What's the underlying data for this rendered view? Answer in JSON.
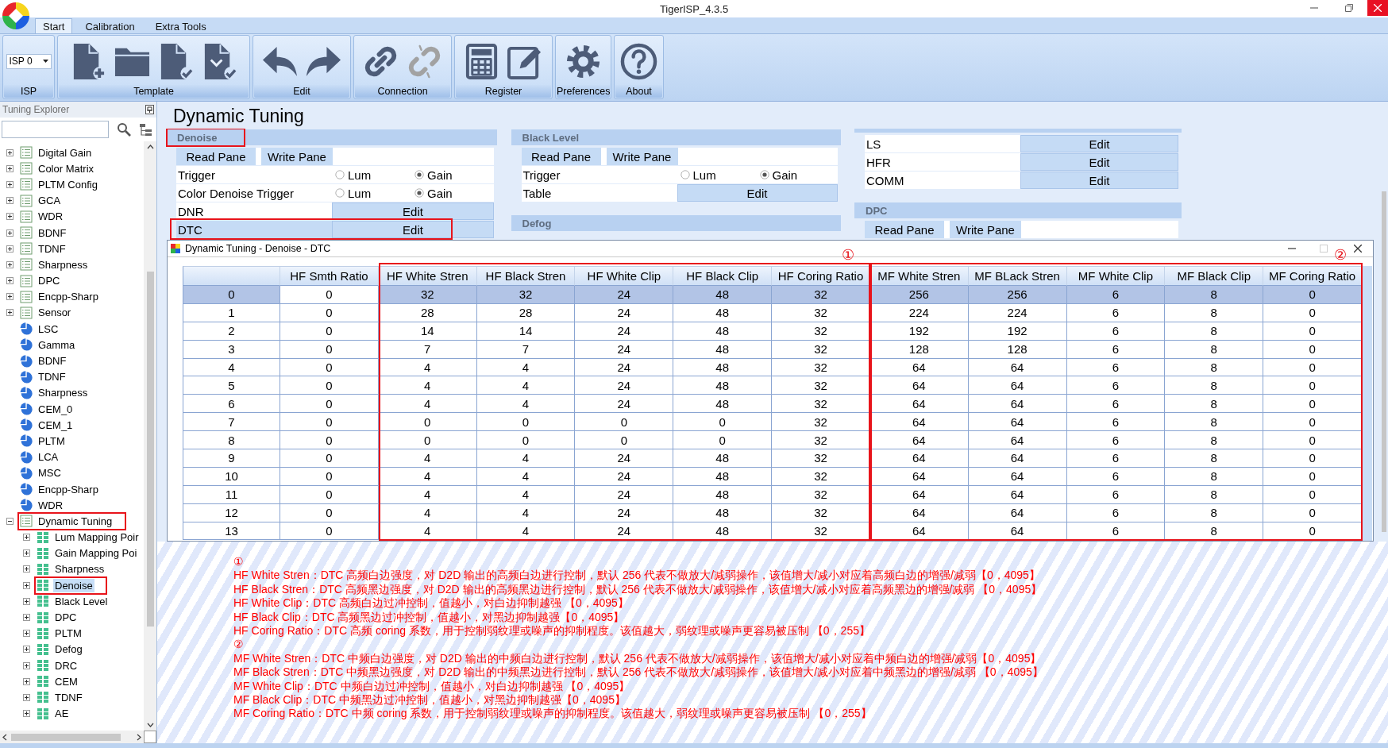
{
  "window": {
    "title": "TigerISP_4.3.5",
    "controls": [
      {
        "kind": "minimize"
      },
      {
        "kind": "restore"
      },
      {
        "kind": "close"
      }
    ]
  },
  "ribbon": {
    "tabs": [
      {
        "label": "Start",
        "selected": true
      },
      {
        "label": "Calibration",
        "selected": false
      },
      {
        "label": "Extra Tools",
        "selected": false
      }
    ],
    "groups": [
      {
        "label": "ISP",
        "dropdown": {
          "value": "ISP 0"
        }
      },
      {
        "label": "Template",
        "tools": [
          {
            "kind": "newfile",
            "disabled": false
          },
          {
            "kind": "folder",
            "disabled": false
          },
          {
            "kind": "filecheck",
            "disabled": false
          },
          {
            "kind": "filesave",
            "disabled": false
          }
        ]
      },
      {
        "label": "Edit",
        "tools": [
          {
            "kind": "undo",
            "disabled": false
          },
          {
            "kind": "redo",
            "disabled": false
          }
        ]
      },
      {
        "label": "Connection",
        "tools": [
          {
            "kind": "link",
            "disabled": false
          },
          {
            "kind": "unlink",
            "disabled": true
          }
        ]
      },
      {
        "label": "Register",
        "tools": [
          {
            "kind": "calculator",
            "disabled": false
          },
          {
            "kind": "edit",
            "disabled": false
          }
        ]
      },
      {
        "label": "Preferences",
        "tools": [
          {
            "kind": "gear",
            "disabled": false
          }
        ]
      },
      {
        "label": "About",
        "tools": [
          {
            "kind": "help",
            "disabled": false
          }
        ]
      }
    ]
  },
  "explorer": {
    "title": "Tuning Explorer",
    "items": [
      {
        "label": "Digital Gain",
        "kind": "node",
        "expanded": false,
        "selected": false,
        "annotated": false
      },
      {
        "label": "Color Matrix",
        "kind": "node",
        "expanded": false,
        "selected": false,
        "annotated": false
      },
      {
        "label": "PLTM Config",
        "kind": "node",
        "expanded": false,
        "selected": false,
        "annotated": false
      },
      {
        "label": "GCA",
        "kind": "node",
        "expanded": false,
        "selected": false,
        "annotated": false
      },
      {
        "label": "WDR",
        "kind": "node",
        "expanded": false,
        "selected": false,
        "annotated": false
      },
      {
        "label": "BDNF",
        "kind": "node",
        "expanded": false,
        "selected": false,
        "annotated": false
      },
      {
        "label": "TDNF",
        "kind": "node",
        "expanded": false,
        "selected": false,
        "annotated": false
      },
      {
        "label": "Sharpness",
        "kind": "node",
        "expanded": false,
        "selected": false,
        "annotated": false
      },
      {
        "label": "DPC",
        "kind": "node",
        "expanded": false,
        "selected": false,
        "annotated": false
      },
      {
        "label": "Encpp-Sharp",
        "kind": "node",
        "expanded": false,
        "selected": false,
        "annotated": false
      },
      {
        "label": "Sensor",
        "kind": "node",
        "expanded": false,
        "selected": false,
        "annotated": false
      },
      {
        "label": "LSC",
        "kind": "leaf",
        "selected": false,
        "annotated": false
      },
      {
        "label": "Gamma",
        "kind": "leaf",
        "selected": false,
        "annotated": false
      },
      {
        "label": "BDNF",
        "kind": "leaf",
        "selected": false,
        "annotated": false
      },
      {
        "label": "TDNF",
        "kind": "leaf",
        "selected": false,
        "annotated": false
      },
      {
        "label": "Sharpness",
        "kind": "leaf",
        "selected": false,
        "annotated": false
      },
      {
        "label": "CEM_0",
        "kind": "leaf",
        "selected": false,
        "annotated": false
      },
      {
        "label": "CEM_1",
        "kind": "leaf",
        "selected": false,
        "annotated": false
      },
      {
        "label": "PLTM",
        "kind": "leaf",
        "selected": false,
        "annotated": false
      },
      {
        "label": "LCA",
        "kind": "leaf",
        "selected": false,
        "annotated": false
      },
      {
        "label": "MSC",
        "kind": "leaf",
        "selected": false,
        "annotated": false
      },
      {
        "label": "Encpp-Sharp",
        "kind": "leaf",
        "selected": false,
        "annotated": false
      },
      {
        "label": "WDR",
        "kind": "leaf",
        "selected": false,
        "annotated": false
      },
      {
        "label": "Dynamic Tuning",
        "kind": "node",
        "expanded": true,
        "selected": false,
        "annotated": true,
        "children": [
          {
            "label": "Lum Mapping Poir",
            "kind": "grid",
            "expanded": false,
            "selected": false,
            "annotated": false
          },
          {
            "label": "Gain Mapping Poi",
            "kind": "grid",
            "expanded": false,
            "selected": false,
            "annotated": false
          },
          {
            "label": "Sharpness",
            "kind": "grid",
            "expanded": false,
            "selected": false,
            "annotated": false
          },
          {
            "label": "Denoise",
            "kind": "grid",
            "expanded": false,
            "selected": true,
            "annotated": true
          },
          {
            "label": "Black Level",
            "kind": "grid",
            "expanded": false,
            "selected": false,
            "annotated": false
          },
          {
            "label": "DPC",
            "kind": "grid",
            "expanded": false,
            "selected": false,
            "annotated": false
          },
          {
            "label": "PLTM",
            "kind": "grid",
            "expanded": false,
            "selected": false,
            "annotated": false
          },
          {
            "label": "Defog",
            "kind": "grid",
            "expanded": false,
            "selected": false,
            "annotated": false
          },
          {
            "label": "DRC",
            "kind": "grid",
            "expanded": false,
            "selected": false,
            "annotated": false
          },
          {
            "label": "CEM",
            "kind": "grid",
            "expanded": false,
            "selected": false,
            "annotated": false
          },
          {
            "label": "TDNF",
            "kind": "grid",
            "expanded": false,
            "selected": false,
            "annotated": false
          },
          {
            "label": "AE",
            "kind": "grid",
            "expanded": false,
            "selected": false,
            "annotated": false
          }
        ]
      }
    ]
  },
  "page": {
    "title": "Dynamic Tuning",
    "columns": [
      {
        "panels": [
          {
            "title": "Denoise",
            "annotated": true,
            "pane_buttons": [
              "Read Pane",
              "Write Pane"
            ],
            "rows": [
              {
                "kind": "radio",
                "label": "Trigger",
                "selected": false,
                "annotated": false,
                "options": [
                  {
                    "label": "Lum",
                    "selected": false
                  },
                  {
                    "label": "Gain",
                    "selected": true
                  }
                ]
              },
              {
                "kind": "radio",
                "label": "Color Denoise Trigger",
                "selected": false,
                "annotated": false,
                "options": [
                  {
                    "label": "Lum",
                    "selected": false
                  },
                  {
                    "label": "Gain",
                    "selected": true
                  }
                ]
              },
              {
                "kind": "edit",
                "label": "DNR",
                "button": "Edit",
                "selected": false,
                "annotated": false
              },
              {
                "kind": "edit",
                "label": "DTC",
                "button": "Edit",
                "selected": true,
                "annotated": true
              }
            ]
          }
        ]
      },
      {
        "panels": [
          {
            "title": "Black Level",
            "annotated": false,
            "pane_buttons": [
              "Read Pane",
              "Write Pane"
            ],
            "rows": [
              {
                "kind": "radio",
                "label": "Trigger",
                "selected": false,
                "annotated": false,
                "options": [
                  {
                    "label": "Lum",
                    "selected": false
                  },
                  {
                    "label": "Gain",
                    "selected": true
                  }
                ]
              },
              {
                "kind": "edit",
                "label": "Table",
                "button": "Edit",
                "selected": false,
                "annotated": false
              }
            ]
          },
          {
            "title": "Defog",
            "annotated": false
          }
        ]
      },
      {
        "panels": [
          {
            "rows": [
              {
                "kind": "edit",
                "label": "LS",
                "button": "Edit",
                "selected": false,
                "annotated": false
              },
              {
                "kind": "edit",
                "label": "HFR",
                "button": "Edit",
                "selected": false,
                "annotated": false
              },
              {
                "kind": "edit",
                "label": "COMM",
                "button": "Edit",
                "selected": false,
                "annotated": false
              }
            ]
          },
          {
            "title": "DPC",
            "annotated": false,
            "pane_buttons": [
              "Read Pane",
              "Write Pane"
            ]
          }
        ]
      }
    ]
  },
  "dialog": {
    "title": "Dynamic Tuning - Denoise - DTC",
    "controls": [
      {
        "kind": "minimize",
        "disabled": false
      },
      {
        "kind": "maximize",
        "disabled": true
      },
      {
        "kind": "close",
        "disabled": false
      }
    ],
    "table": {
      "column_groups": [
        {
          "columns": [
            {
              "label": "HF Smth Ratio",
              "selected": true
            }
          ]
        },
        {
          "callout": "①",
          "columns": [
            {
              "label": "HF White Stren",
              "selected": false
            },
            {
              "label": "HF Black Stren",
              "selected": false
            },
            {
              "label": "HF White Clip",
              "selected": false
            },
            {
              "label": "HF Black Clip",
              "selected": false
            },
            {
              "label": "HF Coring Ratio",
              "selected": false
            }
          ]
        },
        {
          "callout": "②",
          "columns": [
            {
              "label": "MF White Stren",
              "selected": false
            },
            {
              "label": "MF BLack Stren",
              "selected": false
            },
            {
              "label": "MF White Clip",
              "selected": false
            },
            {
              "label": "MF Black Clip",
              "selected": false
            },
            {
              "label": "MF Coring Ratio",
              "selected": false
            }
          ]
        }
      ],
      "rows": [
        {
          "label": "0",
          "selected": true,
          "cells": [
            "0",
            "32",
            "32",
            "24",
            "48",
            "32",
            "256",
            "256",
            "6",
            "8",
            "0"
          ]
        },
        {
          "label": "1",
          "selected": false,
          "cells": [
            "0",
            "28",
            "28",
            "24",
            "48",
            "32",
            "224",
            "224",
            "6",
            "8",
            "0"
          ]
        },
        {
          "label": "2",
          "selected": false,
          "cells": [
            "0",
            "14",
            "14",
            "24",
            "48",
            "32",
            "192",
            "192",
            "6",
            "8",
            "0"
          ]
        },
        {
          "label": "3",
          "selected": false,
          "cells": [
            "0",
            "7",
            "7",
            "24",
            "48",
            "32",
            "128",
            "128",
            "6",
            "8",
            "0"
          ]
        },
        {
          "label": "4",
          "selected": false,
          "cells": [
            "0",
            "4",
            "4",
            "24",
            "48",
            "32",
            "64",
            "64",
            "6",
            "8",
            "0"
          ]
        },
        {
          "label": "5",
          "selected": false,
          "cells": [
            "0",
            "4",
            "4",
            "24",
            "48",
            "32",
            "64",
            "64",
            "6",
            "8",
            "0"
          ]
        },
        {
          "label": "6",
          "selected": false,
          "cells": [
            "0",
            "4",
            "4",
            "24",
            "48",
            "32",
            "64",
            "64",
            "6",
            "8",
            "0"
          ]
        },
        {
          "label": "7",
          "selected": false,
          "cells": [
            "0",
            "0",
            "0",
            "0",
            "0",
            "32",
            "64",
            "64",
            "6",
            "8",
            "0"
          ]
        },
        {
          "label": "8",
          "selected": false,
          "cells": [
            "0",
            "0",
            "0",
            "0",
            "0",
            "32",
            "64",
            "64",
            "6",
            "8",
            "0"
          ]
        },
        {
          "label": "9",
          "selected": false,
          "cells": [
            "0",
            "4",
            "4",
            "24",
            "48",
            "32",
            "64",
            "64",
            "6",
            "8",
            "0"
          ]
        },
        {
          "label": "10",
          "selected": false,
          "cells": [
            "0",
            "4",
            "4",
            "24",
            "48",
            "32",
            "64",
            "64",
            "6",
            "8",
            "0"
          ]
        },
        {
          "label": "11",
          "selected": false,
          "cells": [
            "0",
            "4",
            "4",
            "24",
            "48",
            "32",
            "64",
            "64",
            "6",
            "8",
            "0"
          ]
        },
        {
          "label": "12",
          "selected": false,
          "cells": [
            "0",
            "4",
            "4",
            "24",
            "48",
            "32",
            "64",
            "64",
            "6",
            "8",
            "0"
          ]
        },
        {
          "label": "13",
          "selected": false,
          "cells": [
            "0",
            "4",
            "4",
            "24",
            "48",
            "32",
            "64",
            "64",
            "6",
            "8",
            "0"
          ]
        }
      ]
    }
  },
  "notes": [
    {
      "marker": "①",
      "lines": [
        "HF White Stren：DTC 高频白边强度，对 D2D 输出的高频白边进行控制，默认 256 代表不做放大/减弱操作，该值增大/减小对应着高频白边的增强/减弱【0，4095】",
        "HF Black Stren：DTC 高频黑边强度，对 D2D 输出的高频黑边进行控制，默认 256 代表不做放大/减弱操作，该值增大/减小对应着高频黑边的增强/减弱 【0，4095】",
        "HF White Clip：DTC 高频白边过冲控制，值越小，对白边抑制越强 【0，4095】",
        "HF Black Clip：DTC 高频黑边过冲控制，值越小，对黑边抑制越强【0，4095】",
        "HF Coring Ratio：DTC 高频 coring 系数，用于控制弱纹理或噪声的抑制程度。该值越大，弱纹理或噪声更容易被压制 【0，255】"
      ]
    },
    {
      "marker": "②",
      "lines": [
        "MF White Stren：DTC 中频白边强度，对 D2D 输出的中频白边进行控制，默认 256 代表不做放大/减弱操作，该值增大/减小对应着中频白边的增强/减弱【0，4095】",
        "MF Black Stren：DTC 中频黑边强度，对 D2D 输出的中频黑边进行控制，默认 256 代表不做放大/减弱操作，该值增大/减小对应着中频黑边的增强/减弱 【0，4095】",
        "MF White Clip：DTC 中频白边过冲控制，值越小，对白边抑制越强 【0，4095】",
        "MF Black Clip：DTC 中频黑边过冲控制，值越小，对黑边抑制越强【0，4095】",
        "MF Coring Ratio：DTC 中频 coring 系数，用于控制弱纹理或噪声的抑制程度。该值越大，弱纹理或噪声更容易被压制 【0，255】"
      ]
    }
  ]
}
